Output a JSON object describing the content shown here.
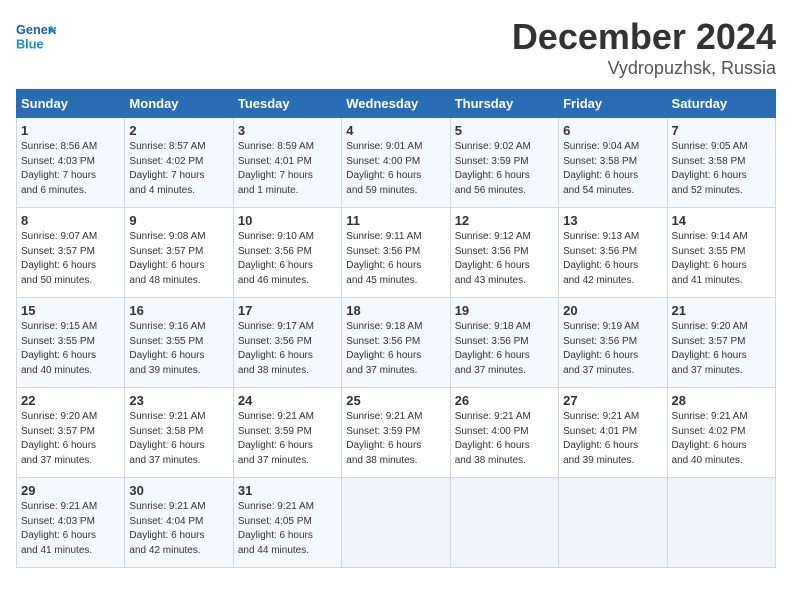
{
  "header": {
    "logo_line1": "General",
    "logo_line2": "Blue",
    "month": "December 2024",
    "location": "Vydropuzhsk, Russia"
  },
  "weekdays": [
    "Sunday",
    "Monday",
    "Tuesday",
    "Wednesday",
    "Thursday",
    "Friday",
    "Saturday"
  ],
  "weeks": [
    [
      {
        "day": "1",
        "sunrise": "8:56 AM",
        "sunset": "4:03 PM",
        "daylight": "7 hours and 6 minutes."
      },
      {
        "day": "2",
        "sunrise": "8:57 AM",
        "sunset": "4:02 PM",
        "daylight": "7 hours and 4 minutes."
      },
      {
        "day": "3",
        "sunrise": "8:59 AM",
        "sunset": "4:01 PM",
        "daylight": "7 hours and 1 minute."
      },
      {
        "day": "4",
        "sunrise": "9:01 AM",
        "sunset": "4:00 PM",
        "daylight": "6 hours and 59 minutes."
      },
      {
        "day": "5",
        "sunrise": "9:02 AM",
        "sunset": "3:59 PM",
        "daylight": "6 hours and 56 minutes."
      },
      {
        "day": "6",
        "sunrise": "9:04 AM",
        "sunset": "3:58 PM",
        "daylight": "6 hours and 54 minutes."
      },
      {
        "day": "7",
        "sunrise": "9:05 AM",
        "sunset": "3:58 PM",
        "daylight": "6 hours and 52 minutes."
      }
    ],
    [
      {
        "day": "8",
        "sunrise": "9:07 AM",
        "sunset": "3:57 PM",
        "daylight": "6 hours and 50 minutes."
      },
      {
        "day": "9",
        "sunrise": "9:08 AM",
        "sunset": "3:57 PM",
        "daylight": "6 hours and 48 minutes."
      },
      {
        "day": "10",
        "sunrise": "9:10 AM",
        "sunset": "3:56 PM",
        "daylight": "6 hours and 46 minutes."
      },
      {
        "day": "11",
        "sunrise": "9:11 AM",
        "sunset": "3:56 PM",
        "daylight": "6 hours and 45 minutes."
      },
      {
        "day": "12",
        "sunrise": "9:12 AM",
        "sunset": "3:56 PM",
        "daylight": "6 hours and 43 minutes."
      },
      {
        "day": "13",
        "sunrise": "9:13 AM",
        "sunset": "3:56 PM",
        "daylight": "6 hours and 42 minutes."
      },
      {
        "day": "14",
        "sunrise": "9:14 AM",
        "sunset": "3:55 PM",
        "daylight": "6 hours and 41 minutes."
      }
    ],
    [
      {
        "day": "15",
        "sunrise": "9:15 AM",
        "sunset": "3:55 PM",
        "daylight": "6 hours and 40 minutes."
      },
      {
        "day": "16",
        "sunrise": "9:16 AM",
        "sunset": "3:55 PM",
        "daylight": "6 hours and 39 minutes."
      },
      {
        "day": "17",
        "sunrise": "9:17 AM",
        "sunset": "3:56 PM",
        "daylight": "6 hours and 38 minutes."
      },
      {
        "day": "18",
        "sunrise": "9:18 AM",
        "sunset": "3:56 PM",
        "daylight": "6 hours and 37 minutes."
      },
      {
        "day": "19",
        "sunrise": "9:18 AM",
        "sunset": "3:56 PM",
        "daylight": "6 hours and 37 minutes."
      },
      {
        "day": "20",
        "sunrise": "9:19 AM",
        "sunset": "3:56 PM",
        "daylight": "6 hours and 37 minutes."
      },
      {
        "day": "21",
        "sunrise": "9:20 AM",
        "sunset": "3:57 PM",
        "daylight": "6 hours and 37 minutes."
      }
    ],
    [
      {
        "day": "22",
        "sunrise": "9:20 AM",
        "sunset": "3:57 PM",
        "daylight": "6 hours and 37 minutes."
      },
      {
        "day": "23",
        "sunrise": "9:21 AM",
        "sunset": "3:58 PM",
        "daylight": "6 hours and 37 minutes."
      },
      {
        "day": "24",
        "sunrise": "9:21 AM",
        "sunset": "3:59 PM",
        "daylight": "6 hours and 37 minutes."
      },
      {
        "day": "25",
        "sunrise": "9:21 AM",
        "sunset": "3:59 PM",
        "daylight": "6 hours and 38 minutes."
      },
      {
        "day": "26",
        "sunrise": "9:21 AM",
        "sunset": "4:00 PM",
        "daylight": "6 hours and 38 minutes."
      },
      {
        "day": "27",
        "sunrise": "9:21 AM",
        "sunset": "4:01 PM",
        "daylight": "6 hours and 39 minutes."
      },
      {
        "day": "28",
        "sunrise": "9:21 AM",
        "sunset": "4:02 PM",
        "daylight": "6 hours and 40 minutes."
      }
    ],
    [
      {
        "day": "29",
        "sunrise": "9:21 AM",
        "sunset": "4:03 PM",
        "daylight": "6 hours and 41 minutes."
      },
      {
        "day": "30",
        "sunrise": "9:21 AM",
        "sunset": "4:04 PM",
        "daylight": "6 hours and 42 minutes."
      },
      {
        "day": "31",
        "sunrise": "9:21 AM",
        "sunset": "4:05 PM",
        "daylight": "6 hours and 44 minutes."
      },
      null,
      null,
      null,
      null
    ]
  ]
}
